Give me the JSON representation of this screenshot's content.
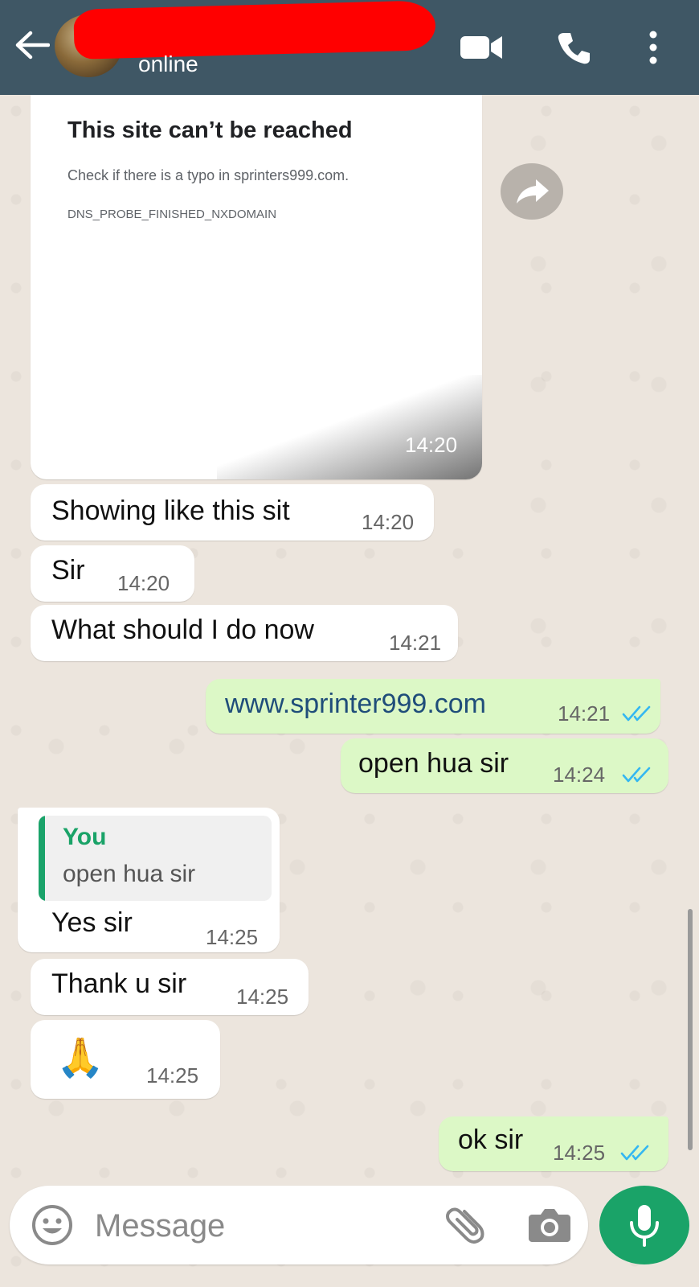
{
  "header": {
    "status": "online",
    "colors": {
      "bar": "#3f5765",
      "redaction": "#ff0000"
    },
    "icons": [
      "back-arrow-icon",
      "video-call-icon",
      "phone-icon",
      "more-vert-icon"
    ]
  },
  "screenshot_card": {
    "title": "This site can’t be reached",
    "subtitle": "Check if there is a typo in sprinters999.com.",
    "code": "DNS_PROBE_FINISHED_NXDOMAIN",
    "time": "14:20"
  },
  "messages": [
    {
      "text": "Showing like this sit",
      "time": "14:20",
      "dir": "in"
    },
    {
      "text": "Sir",
      "time": "14:20",
      "dir": "in"
    },
    {
      "text": "What should I do now",
      "time": "14:21",
      "dir": "in"
    },
    {
      "text": "www.sprinter999.com",
      "time": "14:21",
      "dir": "out"
    },
    {
      "text": "open hua sir",
      "time": "14:24",
      "dir": "out"
    },
    {
      "quote_author": "You",
      "quote_text": "open hua sir",
      "text": "Yes sir",
      "time": "14:25",
      "dir": "in"
    },
    {
      "text": "Thank u sir",
      "time": "14:25",
      "dir": "in"
    },
    {
      "text": "🙏",
      "time": "14:25",
      "dir": "in"
    },
    {
      "text": "ok sir",
      "time": "14:25",
      "dir": "out"
    }
  ],
  "input": {
    "placeholder": "Message"
  },
  "colors": {
    "incoming": "#ffffff",
    "outgoing": "#dcf8c6",
    "accent": "#1aa368",
    "link": "#1f4d7a",
    "ticks": "#34b7f1"
  }
}
